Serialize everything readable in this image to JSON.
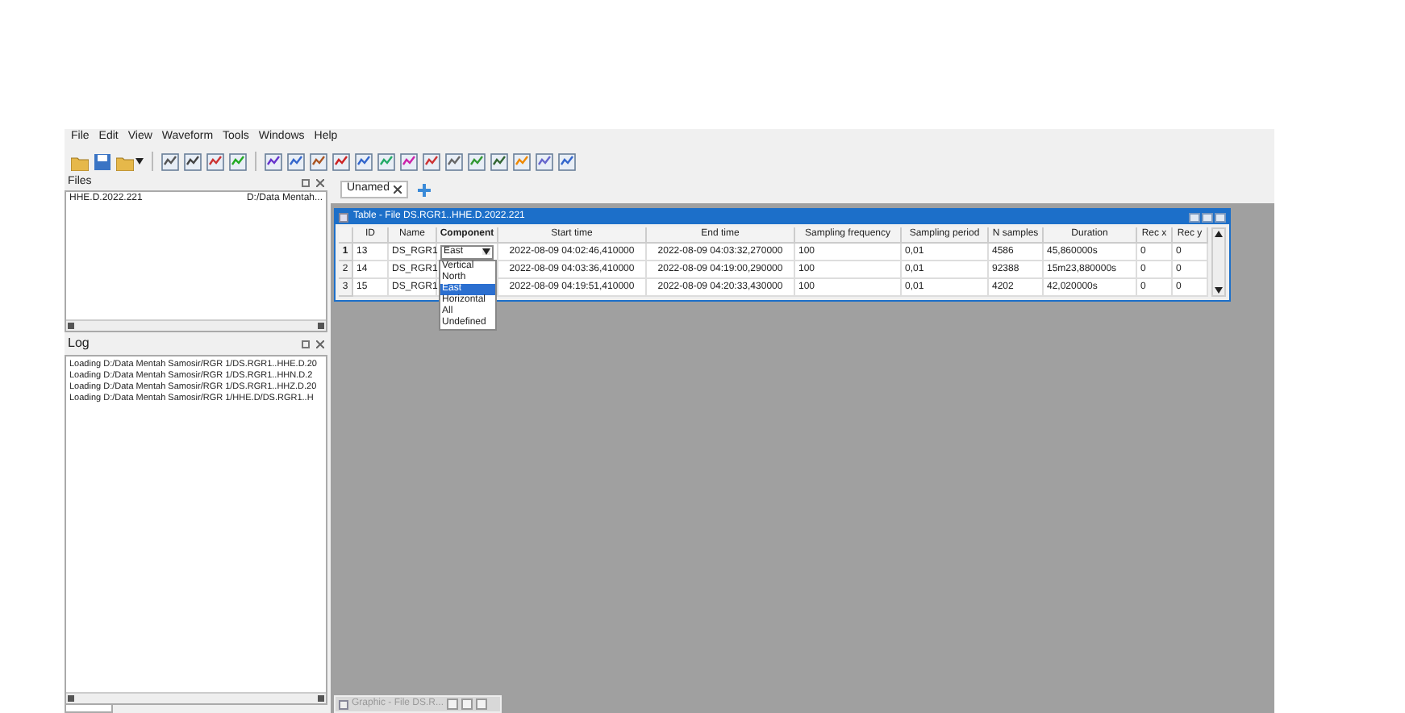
{
  "menu": [
    "File",
    "Edit",
    "View",
    "Waveform",
    "Tools",
    "Windows",
    "Help"
  ],
  "files_panel": {
    "title": "Files",
    "items": [
      {
        "name": "HHE.D.2022.221",
        "path": "D:/Data Mentah..."
      }
    ]
  },
  "log_panel": {
    "title": "Log",
    "lines": [
      "Loading D:/Data Mentah Samosir/RGR 1/DS.RGR1..HHE.D.20",
      "Loading D:/Data Mentah Samosir/RGR 1/DS.RGR1..HHN.D.2",
      "Loading D:/Data Mentah Samosir/RGR 1/DS.RGR1..HHZ.D.20",
      "Loading D:/Data Mentah Samosir/RGR 1/HHE.D/DS.RGR1..H"
    ]
  },
  "workspace_tabs": [
    {
      "label": "Unamed",
      "selected": true
    }
  ],
  "table_window": {
    "title": "Table - File DS.RGR1..HHE.D.2022.221",
    "columns": [
      "ID",
      "Name",
      "Component",
      "Start time",
      "End time",
      "Sampling frequency",
      "Sampling period",
      "N samples",
      "Duration",
      "Rec x",
      "Rec y"
    ],
    "rows": [
      {
        "number": "1",
        "current": true,
        "cells": [
          "13",
          "DS_RGR1",
          "East",
          "2022-08-09 04:02:46,410000",
          "2022-08-09 04:03:32,270000",
          "100",
          "0,01",
          "4586",
          "45,860000s",
          "0",
          "0"
        ],
        "component_dropdown": [
          {
            "label": "Vertical",
            "selected": false
          },
          {
            "label": "North",
            "selected": false
          },
          {
            "label": "East",
            "selected": true
          },
          {
            "label": "Horizontal",
            "selected": false
          },
          {
            "label": "All",
            "selected": false
          },
          {
            "label": "Undefined",
            "selected": false
          }
        ]
      },
      {
        "number": "2",
        "current": false,
        "cells": [
          "14",
          "DS_RGR1",
          "",
          "2022-08-09 04:03:36,410000",
          "2022-08-09 04:19:00,290000",
          "100",
          "0,01",
          "92388",
          "15m23,880000s",
          "0",
          "0"
        ]
      },
      {
        "number": "3",
        "current": false,
        "cells": [
          "15",
          "DS_RGR1",
          "",
          "2022-08-09 04:19:51,410000",
          "2022-08-09 04:20:33,430000",
          "100",
          "0,01",
          "4202",
          "42,020000s",
          "0",
          "0"
        ]
      }
    ]
  },
  "minimized_window": {
    "title": "Graphic - File DS.R..."
  }
}
